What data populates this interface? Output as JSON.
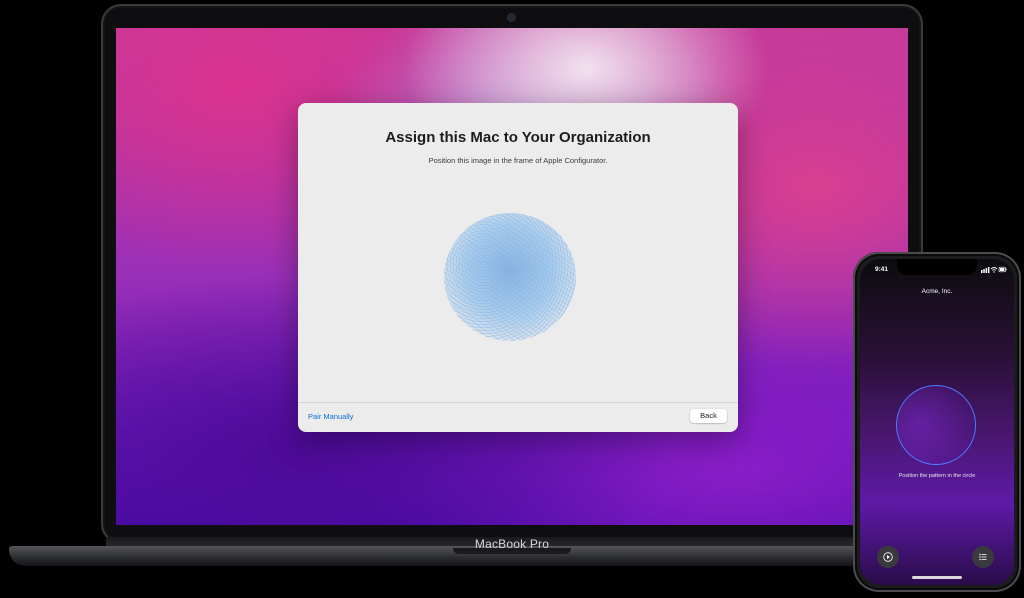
{
  "dialog": {
    "title": "Assign this Mac to Your Organization",
    "subtitle": "Position this image in the frame of Apple Configurator.",
    "pair_manually": "Pair Manually",
    "back": "Back"
  },
  "laptop": {
    "label": "MacBook Pro"
  },
  "phone": {
    "time": "9:41",
    "status_icons": "signal-icon wifi-icon battery-icon",
    "organization": "Acme, Inc.",
    "hint": "Position the pattern in the circle",
    "left_button_icon": "play-icon",
    "right_button_icon": "list-icon"
  },
  "colors": {
    "link": "#0a6ed6",
    "circle_outline": "#4d79ff"
  }
}
